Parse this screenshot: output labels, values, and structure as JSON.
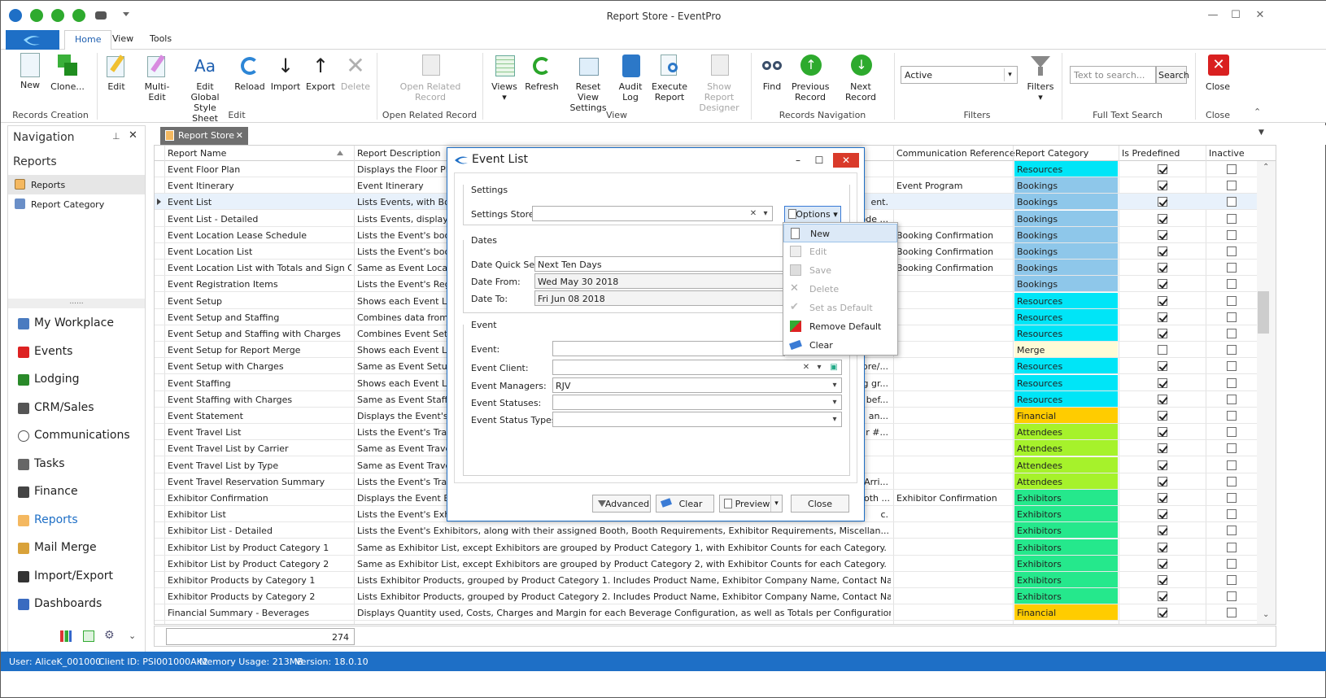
{
  "window": {
    "title": "Report Store - EventPro"
  },
  "tabs": [
    "Home",
    "View",
    "Tools"
  ],
  "ribbon": {
    "records_creation": {
      "label": "Records Creation",
      "new": "New",
      "clone": "Clone..."
    },
    "edit": {
      "label": "Edit",
      "edit": "Edit",
      "multi_edit": "Multi-Edit",
      "edit_global_1": "Edit Global",
      "edit_global_2": "Style Sheet",
      "reload": "Reload",
      "import": "Import",
      "export": "Export",
      "delete": "Delete"
    },
    "open_related": {
      "label": "Open Related Record",
      "btn1": "Open Related",
      "btn2": "Record"
    },
    "view": {
      "label": "View",
      "views": "Views",
      "refresh": "Refresh",
      "reset_1": "Reset View",
      "reset_2": "Settings",
      "audit_1": "Audit",
      "audit_2": "Log",
      "execute_1": "Execute",
      "execute_2": "Report",
      "show_1": "Show Report",
      "show_2": "Designer"
    },
    "records_navigation": {
      "label": "Records Navigation",
      "find": "Find",
      "previous_1": "Previous",
      "previous_2": "Record",
      "next": "Next Record"
    },
    "filters": {
      "label": "Filters",
      "value": "Active",
      "button": "Filters"
    },
    "search": {
      "label": "Full Text Search",
      "placeholder": "Text to search...",
      "button": "Search"
    },
    "close": {
      "label": "Close",
      "button": "Close"
    }
  },
  "doc_tab": "Report Store",
  "nav": {
    "title": "Navigation",
    "section": "Reports",
    "sub": [
      "Reports",
      "Report Category"
    ],
    "dots": "......",
    "items": [
      "My Workplace",
      "Events",
      "Lodging",
      "CRM/Sales",
      "Communications",
      "Tasks",
      "Finance",
      "Reports",
      "Mail Merge",
      "Import/Export",
      "Dashboards"
    ]
  },
  "grid": {
    "columns": [
      "Report Name",
      "Report Description",
      "Communication Reference",
      "Report Category",
      "Is Predefined",
      "Inactive"
    ],
    "rows": [
      {
        "name": "Event Floor Plan",
        "desc": "Displays the Floor Plans",
        "ref": "",
        "cat": "Resources",
        "pre": true
      },
      {
        "name": "Event Itinerary",
        "desc": "Event Itinerary",
        "ref": "Event Program",
        "cat": "Bookings",
        "pre": true
      },
      {
        "name": "Event List",
        "desc": "Lists Events, with Book",
        "ref": "ent.",
        "cat": "Bookings",
        "pre": true
      },
      {
        "name": "Event List - Detailed",
        "desc": "Lists Events, displaying",
        "ref": "ode ...",
        "cat": "Bookings",
        "pre": true
      },
      {
        "name": "Event Location Lease Schedule",
        "desc": "Lists the Event's booked",
        "ref": "Booking Confirmation",
        "cat": "Bookings",
        "pre": true
      },
      {
        "name": "Event Location List",
        "desc": "Lists the Event's booked",
        "ref": "Booking Confirmation",
        "cat": "Bookings",
        "pre": true
      },
      {
        "name": "Event Location List with Totals and Sign Off",
        "desc": "Same as Event Location",
        "ref": "Booking Confirmation",
        "cat": "Bookings",
        "pre": true
      },
      {
        "name": "Event Registration Items",
        "desc": "Lists the Event's Registr",
        "ref": "",
        "cat": "Bookings",
        "pre": true
      },
      {
        "name": "Event Setup",
        "desc": "Shows each Event Loca",
        "ref": "",
        "cat": "Resources",
        "pre": true
      },
      {
        "name": "Event Setup and Staffing",
        "desc": "Combines data from Eve",
        "ref": "",
        "cat": "Resources",
        "pre": true
      },
      {
        "name": "Event Setup and Staffing with Charges",
        "desc": "Combines Event Setup v",
        "ref": "",
        "cat": "Resources",
        "pre": true
      },
      {
        "name": "Event Setup for Report Merge",
        "desc": "Shows each Event Loca",
        "ref": "",
        "cat": "Merge",
        "pre": false
      },
      {
        "name": "Event Setup with Charges",
        "desc": "Same as Event Setup re",
        "ref": "pre/...",
        "cat": "Resources",
        "pre": true
      },
      {
        "name": "Event Staffing",
        "desc": "Shows each Event Loca",
        "ref": "g gr...",
        "cat": "Resources",
        "pre": true
      },
      {
        "name": "Event Staffing with Charges",
        "desc": "Same as Event Staffing",
        "ref": "bef...",
        "cat": "Resources",
        "pre": true
      },
      {
        "name": "Event Statement",
        "desc": "Displays the Event's fina",
        "ref": "an...",
        "cat": "Financial",
        "pre": true
      },
      {
        "name": "Event Travel List",
        "desc": "Lists the Event's Travel",
        "ref": "r #...",
        "cat": "Attendees",
        "pre": true
      },
      {
        "name": "Event Travel List by Carrier",
        "desc": "Same as Event Travel Li",
        "ref": "",
        "cat": "Attendees",
        "pre": true
      },
      {
        "name": "Event Travel List by Type",
        "desc": "Same as Event Travel Li",
        "ref": "",
        "cat": "Attendees",
        "pre": true
      },
      {
        "name": "Event Travel Reservation Summary",
        "desc": "Lists the Event's Travel",
        "ref": "Arri...",
        "cat": "Attendees",
        "pre": true
      },
      {
        "name": "Exhibitor Confirmation",
        "desc": "Displays the Event Exhi",
        "ref": "oth ...",
        "ref2": "Exhibitor Confirmation",
        "cat": "Exhibitors",
        "pre": true
      },
      {
        "name": "Exhibitor List",
        "desc": "Lists the Event's Exhibit",
        "ref": "c.",
        "cat": "Exhibitors",
        "pre": true
      },
      {
        "name": "Exhibitor List - Detailed",
        "desc": "Lists the Event's Exhibitors, along with their assigned Booth, Booth Requirements, Exhibitor Requirements, Miscellan...",
        "ref": "",
        "cat": "Exhibitors",
        "pre": true
      },
      {
        "name": "Exhibitor List by Product Category 1",
        "desc": "Same as Exhibitor List, except Exhibitors are grouped by Product Category 1, with Exhibitor Counts for each Category.",
        "ref": "",
        "cat": "Exhibitors",
        "pre": true
      },
      {
        "name": "Exhibitor List by Product Category 2",
        "desc": "Same as Exhibitor List, except Exhibitors are grouped by Product Category 2, with Exhibitor Counts for each Category.",
        "ref": "",
        "cat": "Exhibitors",
        "pre": true
      },
      {
        "name": "Exhibitor Products by Category 1",
        "desc": "Lists Exhibitor Products, grouped by Product Category 1. Includes Product Name, Exhibitor Company Name, Contact Name, Status, and Bo...",
        "ref": "",
        "cat": "Exhibitors",
        "pre": true
      },
      {
        "name": "Exhibitor Products by Category 2",
        "desc": "Lists Exhibitor Products, grouped by Product Category 2. Includes Product Name, Exhibitor Company Name, Contact Name, Status, and Bo...",
        "ref": "",
        "cat": "Exhibitors",
        "pre": true
      },
      {
        "name": "Financial Summary - Beverages",
        "desc": "Displays Quantity used, Costs, Charges and Margin for each Beverage Configuration, as well as Totals per Configuration Group & Grand To...",
        "ref": "",
        "cat": "Financial",
        "pre": true
      }
    ],
    "count": "274"
  },
  "category_colors": {
    "Resources": "#00e5f7",
    "Bookings": "#8ec7ea",
    "Merge": "#fffbd6",
    "Financial": "#ffcc00",
    "Attendees": "#a6f22b",
    "Exhibitors": "#25e88c"
  },
  "dialog": {
    "title": "Event List",
    "settings": {
      "label": "Settings",
      "store_label": "Settings Store:",
      "store_value": "",
      "options": "Options"
    },
    "dates": {
      "label": "Dates",
      "quick_label": "Date Quick Set:",
      "quick_value": "Next Ten Days",
      "from_label": "Date From:",
      "from_value": "Wed May 30 2018",
      "to_label": "Date To:",
      "to_value": "Fri Jun 08 2018"
    },
    "event": {
      "label": "Event",
      "event_label": "Event:",
      "event_value": "",
      "client_label": "Event Client:",
      "client_value": "",
      "managers_label": "Event Managers:",
      "managers_value": "RJV",
      "statuses_label": "Event Statuses:",
      "statuses_value": "",
      "types_label": "Event Status Types:",
      "types_value": ""
    },
    "buttons": {
      "advanced": "Advanced",
      "clear": "Clear",
      "preview": "Preview",
      "close": "Close"
    }
  },
  "menu": {
    "items": [
      "New",
      "Edit",
      "Save",
      "Delete",
      "Set as Default",
      "Remove Default",
      "Clear"
    ]
  },
  "status": {
    "user": "User: AliceK_001000",
    "client": "Client ID: PSI001000AK2",
    "memory": "Memory Usage: 213MB",
    "version": "Version: 18.0.10"
  }
}
